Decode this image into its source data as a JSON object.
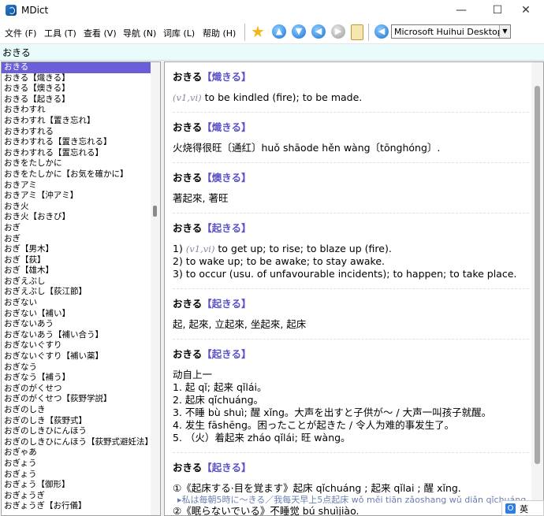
{
  "window": {
    "title": "MDict",
    "min_glyph": "—",
    "max_glyph": "☐",
    "close_glyph": "✕"
  },
  "menu": [
    "文件 (F)",
    "工具 (T)",
    "查看 (V)",
    "导航 (N)",
    "词库 (L)",
    "帮助 (H)"
  ],
  "toolbar": {
    "icons": [
      "star-icon",
      "up-arrow-icon",
      "down-arrow-icon",
      "back-icon",
      "forward-icon",
      "clipboard-icon",
      "audio-icon"
    ],
    "dictionary_selected": "Microsoft Huihui Desktop -"
  },
  "search": {
    "value": "おきる"
  },
  "word_list": [
    "おきる",
    "おきる【熾きる】",
    "おきる【燠きる】",
    "おきる【起きる】",
    "おきわすれ",
    "おきわすれ【置き忘れ】",
    "おきわすれる",
    "おきわすれる【置き忘れる】",
    "おきわすれる【置忘れる】",
    "おきをたしかに",
    "おきをたしかに【お気を確かに】",
    "おきアミ",
    "おきアミ【沖アミ】",
    "おき火",
    "おき火【おきび】",
    "おぎ",
    "おぎ",
    "おぎ【男木】",
    "おぎ【荻】",
    "おぎ【雄木】",
    "おぎえぶし",
    "おぎえぶし【荻江節】",
    "おぎない",
    "おぎない【補い】",
    "おぎないあう",
    "おぎないあう【補い合う】",
    "おぎないぐすり",
    "おぎないぐすり【補い薬】",
    "おぎなう",
    "おぎなう【補う】",
    "おぎのがくせつ",
    "おぎのがくせつ【荻野学説】",
    "おぎのしき",
    "おぎのしき【荻野式】",
    "おぎのしきひにんほう",
    "おぎのしきひにんほう【荻野式避妊法】",
    "おぎゃあ",
    "おぎょう",
    "おぎょう",
    "おぎょう【御形】",
    "おぎょうぎ",
    "おぎょうぎ【お行儀】"
  ],
  "entries": [
    {
      "hw": "おきる",
      "kanji": "【熾きる】",
      "lines": [
        {
          "pos": "(v1,vi)",
          "text": " to be kindled (fire); to be made."
        }
      ]
    },
    {
      "hw": "おきる",
      "kanji": "【熾きる】",
      "lines": [
        {
          "pos": "",
          "text": "火烧得很旺〔通红〕huǒ shāode hěn wàng〔tōnghóng〕."
        }
      ]
    },
    {
      "hw": "おきる",
      "kanji": "【燠きる】",
      "lines": [
        {
          "pos": "",
          "text": "著起來, 著旺"
        }
      ]
    },
    {
      "hw": "おきる",
      "kanji": "【起きる】",
      "lines": [
        {
          "pos": "",
          "pre": "1) ",
          "posi": "(v1,vi)",
          "text": " to get up; to rise; to blaze up (fire)."
        },
        {
          "pos": "",
          "text": "2) to wake up; to be awake; to stay awake."
        },
        {
          "pos": "",
          "text": "3) to occur (usu. of unfavourable incidents); to happen; to take place."
        }
      ]
    },
    {
      "hw": "おきる",
      "kanji": "【起きる】",
      "lines": [
        {
          "pos": "",
          "text": "起, 起來, 立起來, 坐起來, 起床"
        }
      ]
    },
    {
      "hw": "おきる",
      "kanji": "【起きる】",
      "lines": [
        {
          "pos": "",
          "text": "动自上一"
        },
        {
          "pos": "",
          "text": "1. 起 qǐ; 起来 qǐlái。"
        },
        {
          "pos": "",
          "text": "2. 起床 qǐchuáng。"
        },
        {
          "pos": "",
          "text": "3. 不睡 bù shuì; 醒 xǐng。大声を出すと子供が～ / 大声一叫孩子就醒。"
        },
        {
          "pos": "",
          "text": "4. 发生 fāshēng。困ったことが起きた / 令人为难的事发生了。"
        },
        {
          "pos": "",
          "text": "5. （火）着起来 zháo qǐlái; 旺 wàng。"
        }
      ]
    },
    {
      "hw": "おきる",
      "kanji": "【起きる】",
      "lines": [
        {
          "pos": "",
          "text": "①《起床する·目を覚ます》起床 qǐchuáng ; 起来 qǐlai ; 醒 xǐng."
        },
        {
          "ex": "▸私は毎朝5時に～きる／我每天早上5点起床 wǒ měi tiān zǎoshang wǔ diǎn qǐchuáng."
        },
        {
          "pos": "",
          "text": "②《眠らないでいる》不睡觉 bú shuìjiào."
        }
      ]
    }
  ],
  "ime": {
    "icon": "O",
    "label": "英"
  }
}
